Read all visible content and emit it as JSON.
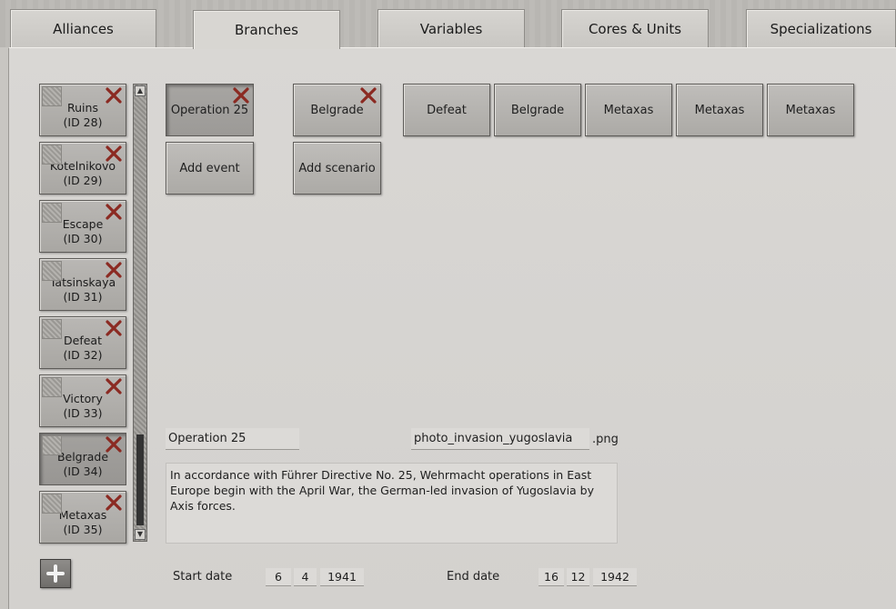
{
  "tabs": [
    {
      "label": "Alliances",
      "active": false
    },
    {
      "label": "Branches",
      "active": true
    },
    {
      "label": "Variables",
      "active": false
    },
    {
      "label": "Cores & Units",
      "active": false
    },
    {
      "label": "Specializations",
      "active": false
    }
  ],
  "scenario_list": [
    {
      "name": "Ruins",
      "id": "(ID 28)"
    },
    {
      "name": "Kotelnikovo",
      "id": "(ID 29)"
    },
    {
      "name": "Escape",
      "id": "(ID 30)"
    },
    {
      "name": "Tatsinskaya",
      "id": "(ID 31)"
    },
    {
      "name": "Defeat",
      "id": "(ID 32)"
    },
    {
      "name": "Victory",
      "id": "(ID 33)"
    },
    {
      "name": "Belgrade",
      "id": "(ID 34)",
      "selected": true
    },
    {
      "name": "Metaxas",
      "id": "(ID 35)"
    }
  ],
  "events": {
    "selected_label": "Operation 25",
    "add_label": "Add event"
  },
  "scenarios": {
    "selected_label": "Belgrade",
    "add_label": "Add scenario"
  },
  "outcomes": [
    "Defeat",
    "Belgrade",
    "Metaxas",
    "Metaxas",
    "Metaxas"
  ],
  "editor": {
    "event_name": "Operation 25",
    "image_name": "photo_invasion_yugoslavia",
    "image_ext": ".png",
    "description": "In accordance with Führer Directive No. 25, Wehrmacht operations in East Europe begin with the April War, the German-led invasion of Yugoslavia by Axis forces.",
    "start_label": "Start date",
    "start_day": "6",
    "start_month": "4",
    "start_year": "1941",
    "end_label": "End date",
    "end_day": "16",
    "end_month": "12",
    "end_year": "1942"
  },
  "colors": {
    "delete_x": "#8b2a22",
    "panel": "#d6d4d1"
  }
}
